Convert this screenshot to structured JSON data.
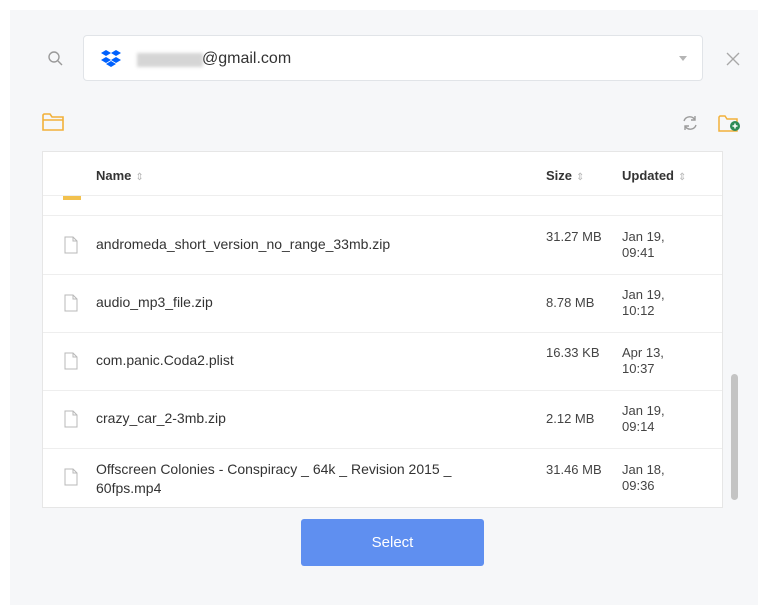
{
  "account": {
    "email_suffix": "@gmail.com",
    "service_icon": "dropbox-icon"
  },
  "list": {
    "columns": {
      "name": "Name",
      "size": "Size",
      "updated": "Updated"
    },
    "sort_indicator": "⇕",
    "files": [
      {
        "name": "andromeda_short_version_no_range_33mb.zip",
        "size": "31.27 MB",
        "updated": "Jan 19, 09:41"
      },
      {
        "name": "audio_mp3_file.zip",
        "size": "8.78 MB",
        "updated": "Jan 19, 10:12"
      },
      {
        "name": "com.panic.Coda2.plist",
        "size": "16.33 KB",
        "updated": "Apr 13, 10:37"
      },
      {
        "name": "crazy_car_2-3mb.zip",
        "size": "2.12 MB",
        "updated": "Jan 19, 09:14"
      },
      {
        "name": "Offscreen Colonies - Conspiracy _ 64k _ Revision 2015 _ 60fps.mp4",
        "size": "31.46 MB",
        "updated": "Jan 18, 09:36"
      }
    ]
  },
  "actions": {
    "select_label": "Select"
  },
  "colors": {
    "accent": "#5f8ff0",
    "folder": "#f2c14e",
    "dropbox": "#0061fe",
    "new_folder_plus": "#2e8b57"
  }
}
